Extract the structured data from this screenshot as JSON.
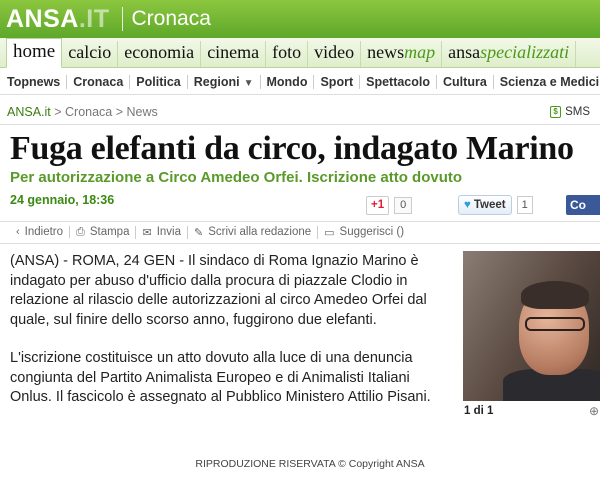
{
  "header": {
    "logo_main": "ANSA",
    "logo_it": ".IT",
    "section": "Cronaca"
  },
  "main_nav": [
    {
      "label": "home"
    },
    {
      "label": "calcio"
    },
    {
      "label": "economia"
    },
    {
      "label": "cinema"
    },
    {
      "label": "foto"
    },
    {
      "label": "video"
    },
    {
      "label": "news",
      "accent": "map"
    },
    {
      "label": "ansa",
      "accent": "specializzati"
    }
  ],
  "sub_nav": [
    "Topnews",
    "Cronaca",
    "Politica",
    "Regioni",
    "Mondo",
    "Sport",
    "Spettacolo",
    "Cultura",
    "Scienza e Medicina"
  ],
  "breadcrumb": {
    "home": "ANSA.it",
    "sep1": " > ",
    "section": "Cronaca",
    "sep2": " > ",
    "current": "News"
  },
  "sms": {
    "label": "SMS",
    "icon": "phone-icon"
  },
  "article": {
    "title": "Fuga elefanti da circo, indagato Marino",
    "subtitle": "Per autorizzazione a Circo Amedeo Orfei. Iscrizione atto dovuto",
    "date": "24 gennaio, 18:36",
    "paragraphs": [
      "(ANSA) - ROMA, 24 GEN - Il sindaco di Roma Ignazio Marino è indagato per abuso d'ufficio dalla procura di piazzale Clodio in relazione al rilascio delle autorizzazioni al circo Amedeo Orfei dal quale, sul finire dello scorso anno, fuggirono due elefanti.",
      "L'iscrizione costituisce un atto dovuto alla luce di una denuncia congiunta del Partito Animalista Europeo e di Animalisti Italiani Onlus. Il fascicolo è assegnato al Pubblico Ministero Attilio Pisani."
    ],
    "copyright": "RIPRODUZIONE RISERVATA © Copyright ANSA"
  },
  "social": {
    "gplus_label": "+1",
    "gplus_count": "0",
    "tweet_label": "Tweet",
    "tweet_count": "1",
    "fb_label": "Co"
  },
  "tools": [
    {
      "label": "Indietro",
      "icon": "back-arrow-icon"
    },
    {
      "label": "Stampa",
      "icon": "print-icon"
    },
    {
      "label": "Invia",
      "icon": "mail-icon"
    },
    {
      "label": "Scrivi alla redazione",
      "icon": "pencil-icon"
    },
    {
      "label": "Suggerisci ()",
      "icon": "comment-icon"
    }
  ],
  "photo": {
    "counter": "1 di 1",
    "icon": "zoom-icon"
  },
  "colors": {
    "brand_green": "#5ea82a",
    "subtitle_green": "#5a9a2a",
    "facebook": "#3b5998"
  }
}
